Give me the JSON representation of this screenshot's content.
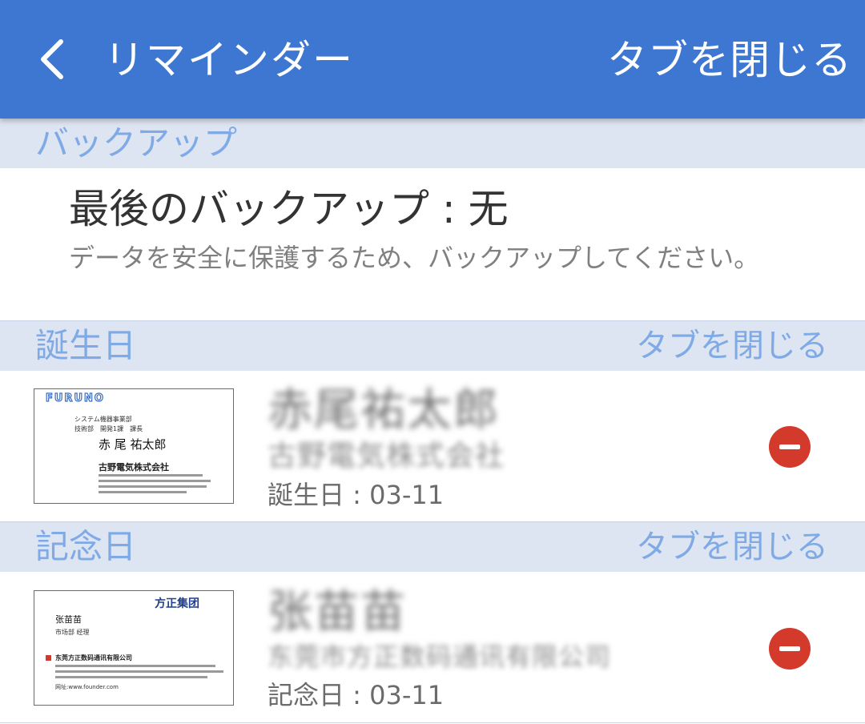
{
  "appbar": {
    "back_icon": "back-chevron-icon",
    "title": "リマインダー",
    "action": "タブを閉じる"
  },
  "backup": {
    "header": "バックアップ",
    "title": "最後のバックアップ : 无",
    "description": "データを安全に保護するため、バックアップしてください。"
  },
  "birthday": {
    "header": "誕生日",
    "action": "タブを閉じる",
    "entry": {
      "name": "赤尾祐太郎",
      "company": "古野電気株式会社",
      "date": "誕生日 : 03-11",
      "remove_icon": "remove-icon",
      "card": {
        "logo": "FURUNO",
        "dept": "システム機器事業部",
        "role": "技術部　開発1課　課長",
        "name": "赤 尾 祐太郎",
        "company": "古野電気株式会社"
      }
    }
  },
  "anniversary": {
    "header": "記念日",
    "action": "タブを閉じる",
    "entry": {
      "name": "张苗苗",
      "company": "东莞市方正数码通讯有限公司",
      "date": "記念日 : 03-11",
      "remove_icon": "remove-icon",
      "card": {
        "logo": "方正集团",
        "name": "张苗苗",
        "role": "市场部 经理",
        "company": "东莞方正数码通讯有限公司",
        "site": "网址:www.founder.com"
      }
    }
  },
  "colors": {
    "appbar": "#3d77d1",
    "section_header_bg": "#dde5f2",
    "section_header_text": "#7faae6",
    "remove": "#d33a2c"
  }
}
